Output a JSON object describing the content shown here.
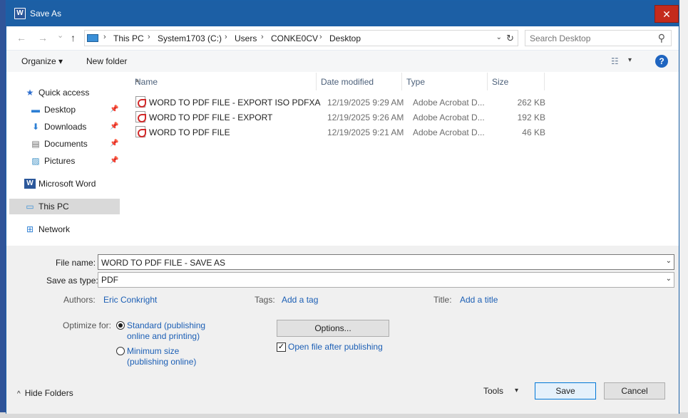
{
  "window": {
    "title": "Save As",
    "app_icon_letter": "W",
    "close_glyph": "✕"
  },
  "navbar": {
    "back_glyph": "←",
    "forward_glyph": "→",
    "recent_glyph": "⌄",
    "up_glyph": "↑",
    "breadcrumbs": [
      "This PC",
      "System1703 (C:)",
      "Users",
      "CONKE0CV",
      "Desktop"
    ],
    "crumb_separator": "›",
    "dropdown_glyph": "⌄",
    "refresh_glyph": "↻",
    "search_placeholder": "Search Desktop",
    "search_glyph": "⚲"
  },
  "toolbar": {
    "organize_label": "Organize ▾",
    "new_folder_label": "New folder",
    "views_glyph": "☷",
    "views_dd_glyph": "▾",
    "help_glyph": "?"
  },
  "nav_pane": {
    "items": [
      {
        "label": "Quick access",
        "icon": "star-icon",
        "glyph": "★",
        "color": "#2f6fcf",
        "pinned": false
      },
      {
        "label": "Desktop",
        "icon": "desktop-icon",
        "glyph": "▬",
        "color": "#2d7fd4",
        "pinned": true
      },
      {
        "label": "Downloads",
        "icon": "download-icon",
        "glyph": "⬇",
        "color": "#2d7fd4",
        "pinned": true
      },
      {
        "label": "Documents",
        "icon": "documents-icon",
        "glyph": "▤",
        "color": "#6b6b6b",
        "pinned": true
      },
      {
        "label": "Pictures",
        "icon": "pictures-icon",
        "glyph": "▨",
        "color": "#3b8fc4",
        "pinned": true
      },
      {
        "label": "Microsoft Word",
        "icon": "word-icon",
        "glyph": "W",
        "color": "#2b579a",
        "pinned": false
      },
      {
        "label": "This PC",
        "icon": "computer-icon",
        "glyph": "▭",
        "color": "#3a8fd7",
        "pinned": false
      },
      {
        "label": "Network",
        "icon": "network-icon",
        "glyph": "⊞",
        "color": "#2d7fd4",
        "pinned": false
      }
    ],
    "pin_glyph": "📌",
    "selected": "This PC"
  },
  "file_list": {
    "columns": [
      "Name",
      "Date modified",
      "Type",
      "Size"
    ],
    "sort_glyph": "▲",
    "rows": [
      {
        "name": "WORD TO PDF FILE - EXPORT ISO PDFXA",
        "date": "12/19/2025 9:29 AM",
        "type": "Adobe Acrobat D...",
        "size": "262 KB"
      },
      {
        "name": "WORD TO PDF FILE - EXPORT",
        "date": "12/19/2025 9:26 AM",
        "type": "Adobe Acrobat D...",
        "size": "192 KB"
      },
      {
        "name": "WORD TO PDF FILE",
        "date": "12/19/2025 9:21 AM",
        "type": "Adobe Acrobat D...",
        "size": "46 KB"
      }
    ]
  },
  "form": {
    "file_name_label": "File name:",
    "file_name_value": "WORD TO PDF FILE - SAVE AS",
    "save_type_label": "Save as type:",
    "save_type_value": "PDF",
    "dd_glyph": "⌄",
    "authors_label": "Authors:",
    "authors_value": "Eric Conkright",
    "tags_label": "Tags:",
    "tags_value": "Add a tag",
    "title_label": "Title:",
    "title_value": "Add a title",
    "optimize_label": "Optimize for:",
    "opt_standard_line1": "Standard (publishing",
    "opt_standard_line2": "online and printing)",
    "opt_minimum_line1": "Minimum size",
    "opt_minimum_line2": "(publishing online)",
    "options_button": "Options...",
    "open_after_label": "Open file after publishing",
    "open_after_checked": true,
    "check_glyph": "✓"
  },
  "footer": {
    "hide_folders_label": "Hide Folders",
    "hide_folders_glyph": "^",
    "tools_label": "Tools",
    "tools_dd_glyph": "▾",
    "save_button": "Save",
    "cancel_button": "Cancel"
  }
}
